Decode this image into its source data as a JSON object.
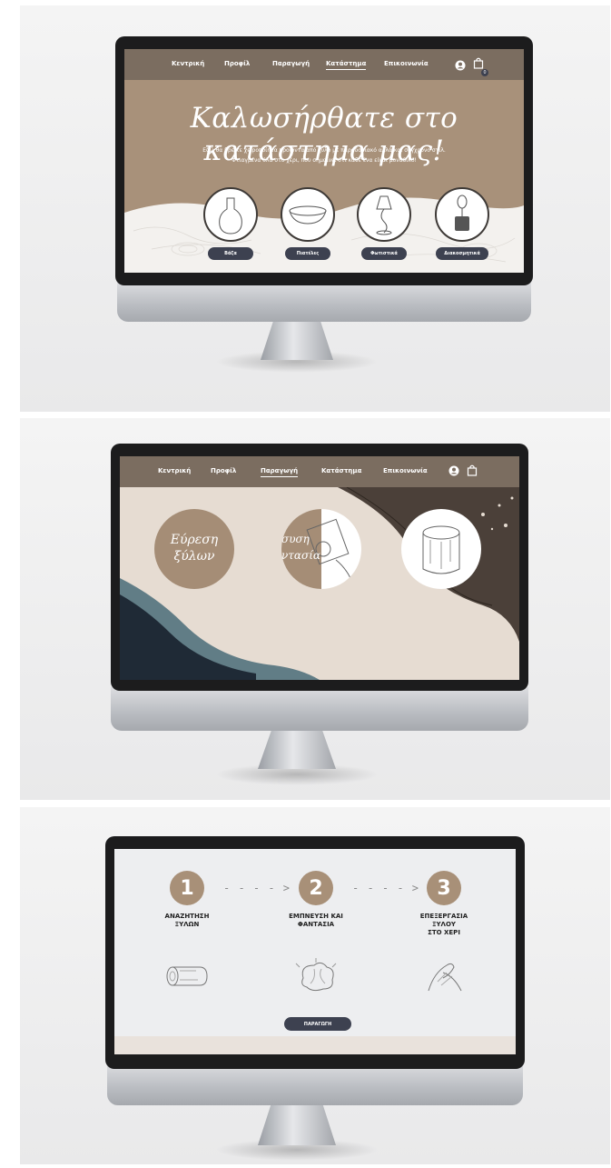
{
  "colors": {
    "nav_bg": "#7b6d60",
    "hero_bg": "#a8917a",
    "button_bg": "#3d4150",
    "step_circle": "#a89078",
    "cream": "#e6dcd2",
    "dark_brown": "#4b4039",
    "dark_navy": "#1f2a36",
    "teal": "#617d86"
  },
  "nav": {
    "items": [
      "Κεντρική",
      "Προφίλ",
      "Παραγωγή",
      "Κατάστημα",
      "Επικοινωνία"
    ],
    "cart_count": "0"
  },
  "screen1": {
    "title": "Καλωσήρθατε στο κατάστημα μας!",
    "subtitle_line1": "Εδώ θα βρείτε χειροποίητα προϊόντα από ξύλο με παραδοσιακό αλλά και σύγχρονο στιλ.",
    "subtitle_line2": "Φτιαγμένα όλα στο χέρι, που σημαίνει ότι κάθε ένα είναι μοναδικό!",
    "products": [
      {
        "label": "Βάζα",
        "icon": "vase-icon"
      },
      {
        "label": "Πιατέλες",
        "icon": "bowl-icon"
      },
      {
        "label": "Φωτιστικά",
        "icon": "lamp-icon"
      },
      {
        "label": "Διακοσμητικά",
        "icon": "decor-icon"
      }
    ]
  },
  "screen2": {
    "circle1_line1": "Εύρεση",
    "circle1_line2": "ξύλων",
    "circle2_line1": "συση",
    "circle2_line2": "ντασία"
  },
  "screen3": {
    "steps": [
      {
        "num": "1",
        "label_line1": "ΑΝΑΖΗΤΗΣΗ",
        "label_line2": "ΞΥΛΩΝ",
        "label_line3": "",
        "icon": "log-icon"
      },
      {
        "num": "2",
        "label_line1": "ΕΜΠΝΕΥΣΗ ΚΑΙ",
        "label_line2": "ΦΑΝΤΑΣΙΑ",
        "label_line3": "",
        "icon": "brain-icon"
      },
      {
        "num": "3",
        "label_line1": "ΕΠΕΞΕΡΓΑΣΙΑ",
        "label_line2": "ΞΥΛΟΥ",
        "label_line3": "ΣΤΟ ΧΕΡΙ",
        "icon": "hands-icon"
      }
    ],
    "arrow": "- - - - >",
    "cta_label": "ΠΑΡΑΓΩΓΗ"
  }
}
